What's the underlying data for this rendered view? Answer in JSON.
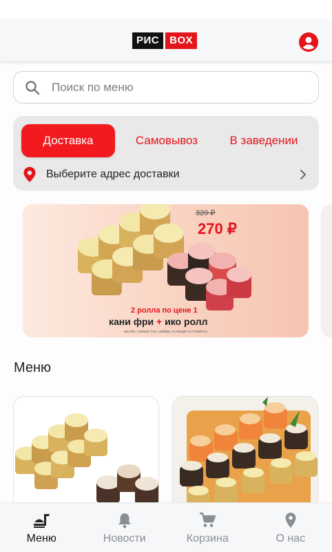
{
  "header": {
    "logo_left": "РИС",
    "logo_right": "BOX",
    "profile_icon": "user-circle-icon"
  },
  "search": {
    "placeholder": "Поиск по меню",
    "icon": "search-icon"
  },
  "delivery": {
    "tabs": [
      {
        "label": "Доставка",
        "active": true
      },
      {
        "label": "Самовывоз",
        "active": false
      },
      {
        "label": "В заведении",
        "active": false
      }
    ],
    "address_prompt": "Выберите адрес доставки"
  },
  "banner": {
    "old_price": "320 ₽",
    "new_price": "270 ₽",
    "offer": "2 ролла по цене 1",
    "product_a": "кани фри",
    "plus": "+",
    "product_b": "ико ролл",
    "footnote": "васаби, соевый соус, имбирь не входят в стоимость"
  },
  "menu": {
    "title": "Меню"
  },
  "tabbar": {
    "items": [
      {
        "label": "Меню",
        "icon": "food-icon",
        "active": true
      },
      {
        "label": "Новости",
        "icon": "bell-icon",
        "active": false
      },
      {
        "label": "Корзина",
        "icon": "cart-icon",
        "active": false
      },
      {
        "label": "О нас",
        "icon": "location-pin-icon",
        "active": false
      }
    ]
  },
  "colors": {
    "accent": "#e4141b",
    "tab_active": "#f21a1f"
  }
}
